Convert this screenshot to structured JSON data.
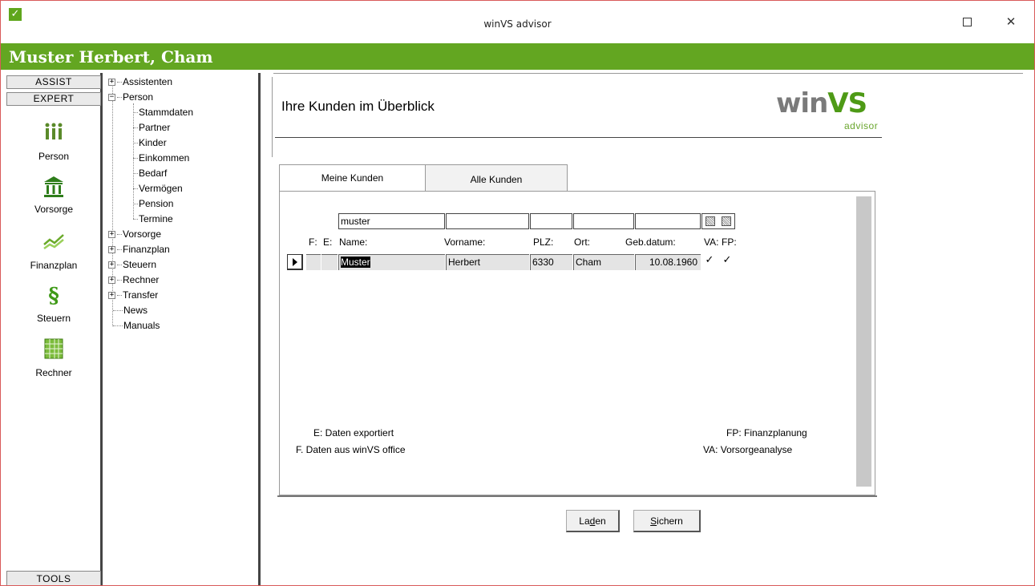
{
  "window": {
    "title": "winVS advisor",
    "app_icon": "check-icon",
    "app_icon_glyph": "✓",
    "maximize_label": "",
    "close_glyph": "✕"
  },
  "header": {
    "client_name": "Muster Herbert, Cham",
    "color": "#63a621"
  },
  "left_nav": {
    "assist": "ASSIST",
    "expert": "EXPERT",
    "items": [
      {
        "label": "Person",
        "icon": "people-icon"
      },
      {
        "label": "Vorsorge",
        "icon": "pillars-icon"
      },
      {
        "label": "Finanzplan",
        "icon": "chart-lines-icon"
      },
      {
        "label": "Steuern",
        "icon": "paragraph-icon"
      },
      {
        "label": "Rechner",
        "icon": "calculator-icon"
      }
    ],
    "tools": "TOOLS"
  },
  "tree": {
    "assistenten": "Assistenten",
    "person": "Person",
    "person_children": [
      "Stammdaten",
      "Partner",
      "Kinder",
      "Einkommen",
      "Bedarf",
      "Vermögen",
      "Pension",
      "Termine"
    ],
    "vorsorge": "Vorsorge",
    "finanzplan": "Finanzplan",
    "steuern": "Steuern",
    "rechner": "Rechner",
    "transfer": "Transfer",
    "news": "News",
    "manuals": "Manuals",
    "plus": "+",
    "minus": "−"
  },
  "main": {
    "title": "Ihre Kunden im Überblick",
    "logo_win": "win",
    "logo_vs": "VS",
    "logo_sub": "advisor",
    "tabs": {
      "meine": "Meine Kunden",
      "alle": "Alle Kunden"
    },
    "filter": {
      "name": "muster",
      "vorname": "",
      "plz": "",
      "ort": "",
      "geb": ""
    },
    "columns": {
      "f": "F:",
      "e": "E:",
      "name": "Name:",
      "vorname": "Vorname:",
      "plz": "PLZ:",
      "ort": "Ort:",
      "geb": "Geb.datum:",
      "va": "VA:",
      "fp": "FP:"
    },
    "rows": [
      {
        "name": "Muster",
        "vorname": "Herbert",
        "plz": "6330",
        "ort": "Cham",
        "geb": "10.08.1960",
        "va": "✓",
        "fp": "✓"
      }
    ],
    "legend": {
      "e": "E: Daten exportiert",
      "f": "F. Daten aus winVS office",
      "fp": "FP: Finanzplanung",
      "va": "VA: Vorsorgeanalyse"
    },
    "buttons": {
      "laden_pre": "La",
      "laden_u": "d",
      "laden_post": "en",
      "sichern_u": "S",
      "sichern_post": "ichern"
    }
  }
}
